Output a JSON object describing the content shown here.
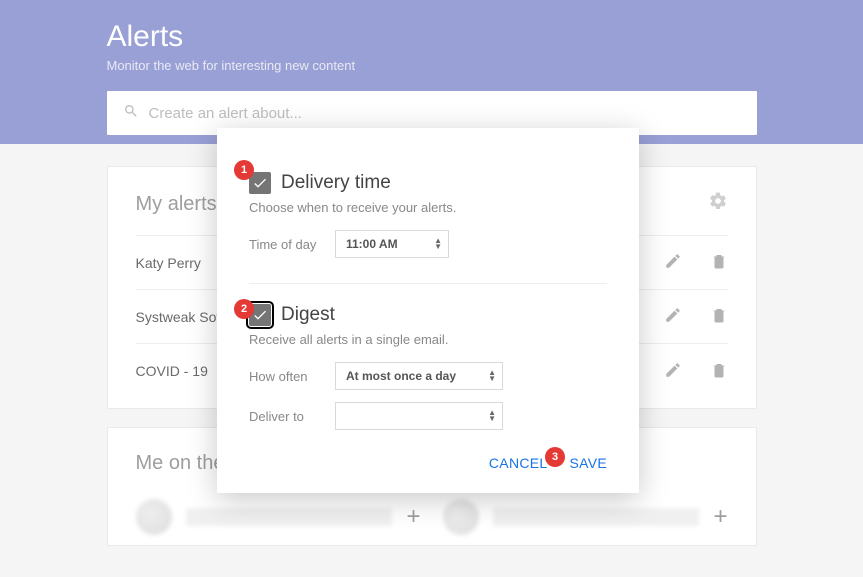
{
  "header": {
    "title": "Alerts",
    "subtitle": "Monitor the web for interesting new content",
    "search_placeholder": "Create an alert about..."
  },
  "my_alerts": {
    "heading": "My alerts",
    "items": [
      {
        "name": "Katy Perry"
      },
      {
        "name": "Systweak Software"
      },
      {
        "name": "COVID - 19"
      }
    ]
  },
  "me_heading": "Me on the web",
  "dialog": {
    "delivery": {
      "title": "Delivery time",
      "desc": "Choose when to receive your alerts.",
      "time_label": "Time of day",
      "time_value": "11:00 AM",
      "checked": true
    },
    "digest": {
      "title": "Digest",
      "desc": "Receive all alerts in a single email.",
      "how_label": "How often",
      "how_value": "At most once a day",
      "deliver_label": "Deliver to",
      "deliver_value": "",
      "checked": true
    },
    "cancel_label": "CANCEL",
    "save_label": "SAVE"
  },
  "callouts": {
    "one": "1",
    "two": "2",
    "three": "3"
  }
}
